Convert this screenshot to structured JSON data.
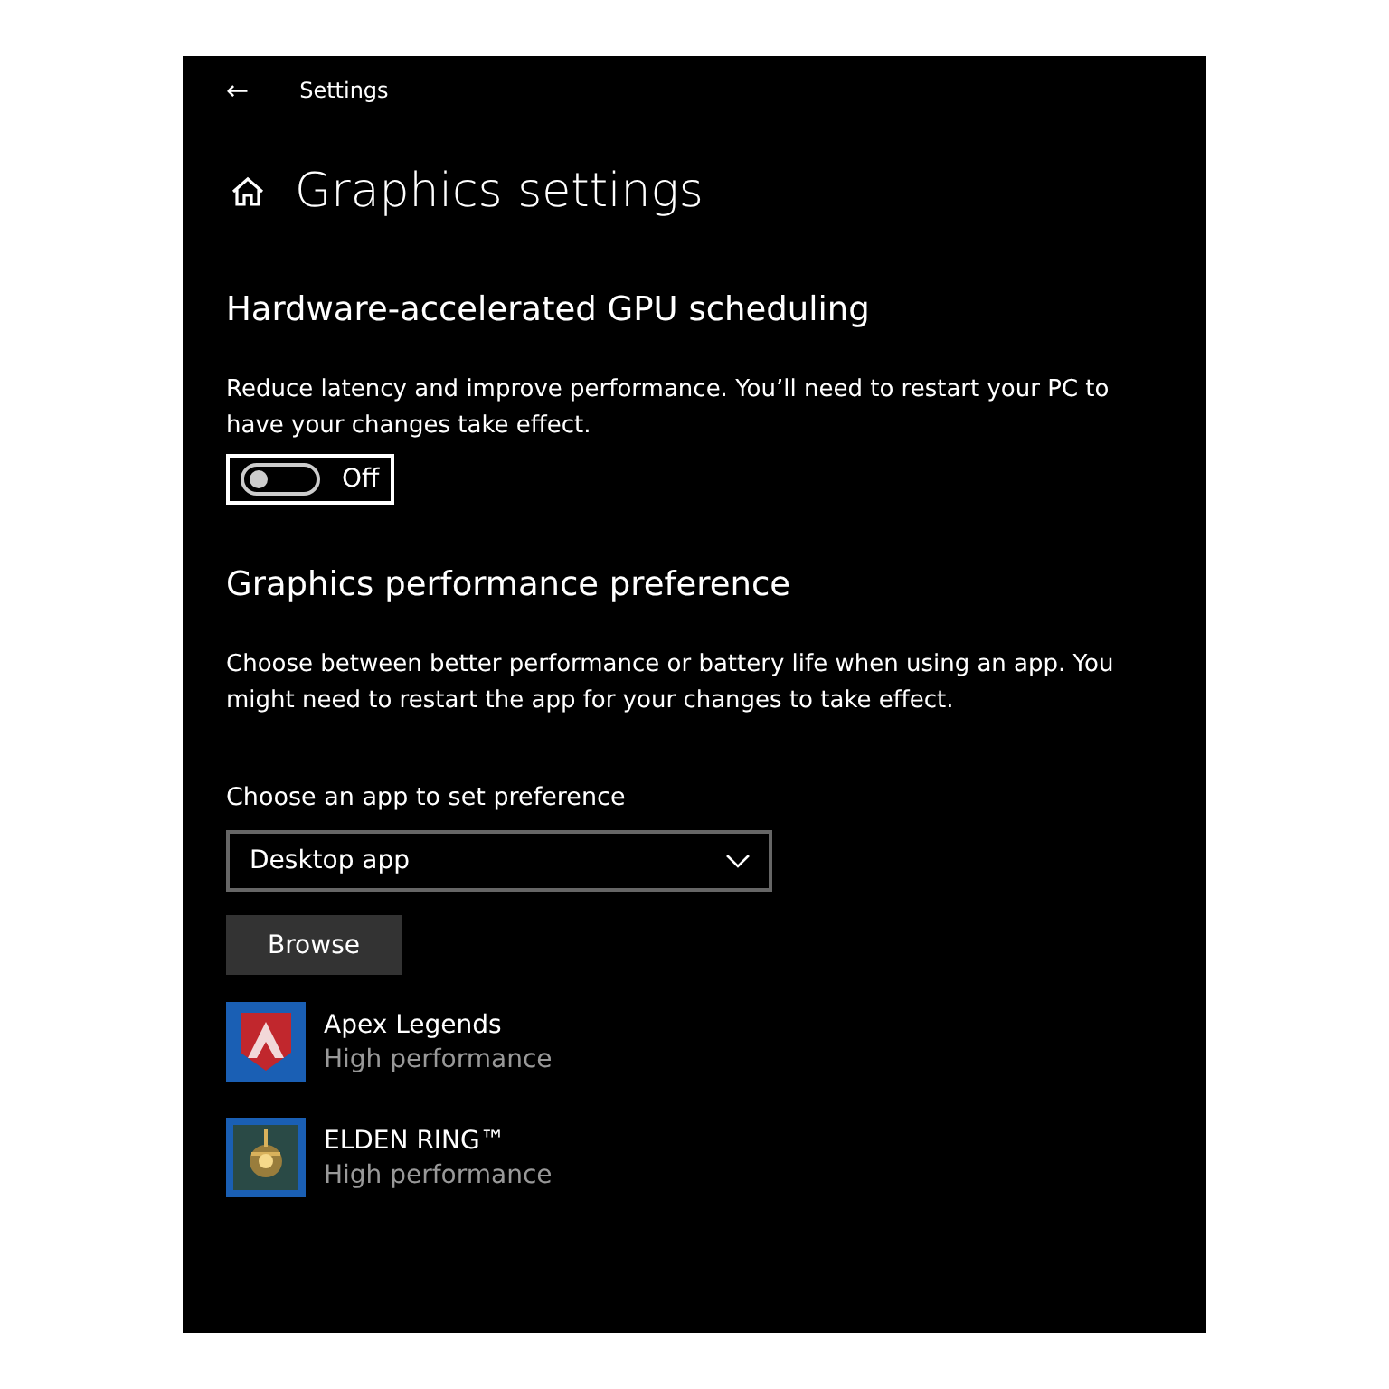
{
  "header": {
    "back": "←",
    "title": "Settings"
  },
  "page_title": "Graphics settings",
  "gpu_scheduling": {
    "heading": "Hardware-accelerated GPU scheduling",
    "description": "Reduce latency and improve performance. You’ll need to restart your PC to have your changes take effect.",
    "toggle": {
      "on": false,
      "focused": true,
      "label": "Off"
    }
  },
  "preference": {
    "heading": "Graphics performance preference",
    "description": "Choose between better performance or battery life when using an app. You might need to restart the app for your changes to take effect.",
    "dropdown_label": "Choose an app to set preference",
    "dropdown_value": "Desktop app",
    "browse_button": "Browse"
  },
  "apps": [
    {
      "name": "Apex Legends",
      "preference": "High performance",
      "kind": "shield"
    },
    {
      "name": "ELDEN RING™",
      "preference": "High performance",
      "kind": "lamp"
    }
  ]
}
